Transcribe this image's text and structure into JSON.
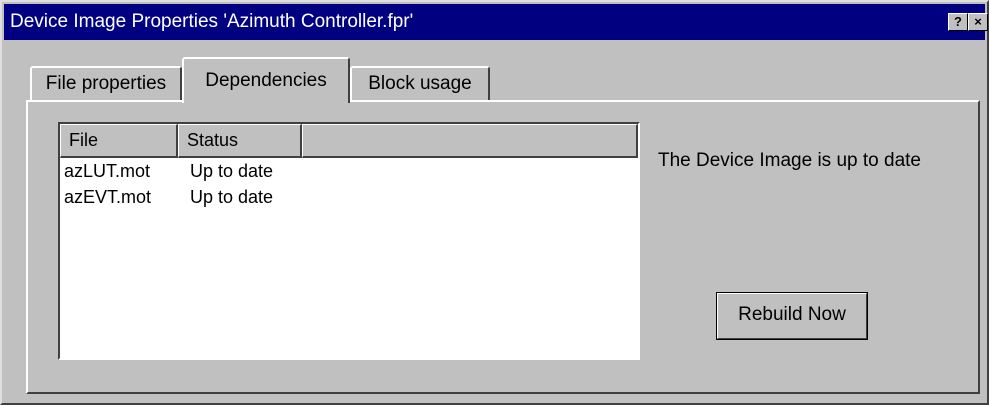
{
  "window": {
    "title": "Device Image Properties 'Azimuth Controller.fpr'",
    "help_button": "?",
    "close_button": "×"
  },
  "tabs": [
    {
      "label": "File properties",
      "selected": false
    },
    {
      "label": "Dependencies",
      "selected": true
    },
    {
      "label": "Block usage",
      "selected": false
    }
  ],
  "dependencies": {
    "columns": [
      "File",
      "Status"
    ],
    "rows": [
      {
        "file": "azLUT.mot",
        "status": "Up to date"
      },
      {
        "file": "azEVT.mot",
        "status": "Up to date"
      }
    ],
    "status_message": "The Device Image is up to date",
    "rebuild_button": "Rebuild Now"
  },
  "colors": {
    "titlebar": "#000080",
    "face": "#c0c0c0",
    "list_background": "#ffffff"
  }
}
